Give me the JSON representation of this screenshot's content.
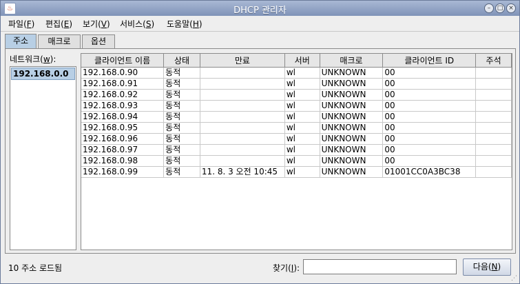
{
  "window": {
    "title": "DHCP 관리자"
  },
  "menu": [
    {
      "label": "파일(",
      "mnemonic": "F",
      "suffix": ")"
    },
    {
      "label": "편집(",
      "mnemonic": "E",
      "suffix": ")"
    },
    {
      "label": "보기(",
      "mnemonic": "V",
      "suffix": ")"
    },
    {
      "label": "서비스(",
      "mnemonic": "S",
      "suffix": ")"
    },
    {
      "label": "도움말(",
      "mnemonic": "H",
      "suffix": ")"
    }
  ],
  "tabs": [
    "주소",
    "매크로",
    "옵션"
  ],
  "network": {
    "label_prefix": "네트워크(",
    "label_mnemonic": "w",
    "label_suffix": "):",
    "items": [
      "192.168.0.0"
    ]
  },
  "table": {
    "columns": [
      "클라이언트 이름",
      "상태",
      "만료",
      "서버",
      "매크로",
      "클라이언트 ID",
      "주석"
    ],
    "rows": [
      [
        "192.168.0.90",
        "동적",
        "",
        "wl",
        "UNKNOWN",
        "00",
        ""
      ],
      [
        "192.168.0.91",
        "동적",
        "",
        "wl",
        "UNKNOWN",
        "00",
        ""
      ],
      [
        "192.168.0.92",
        "동적",
        "",
        "wl",
        "UNKNOWN",
        "00",
        ""
      ],
      [
        "192.168.0.93",
        "동적",
        "",
        "wl",
        "UNKNOWN",
        "00",
        ""
      ],
      [
        "192.168.0.94",
        "동적",
        "",
        "wl",
        "UNKNOWN",
        "00",
        ""
      ],
      [
        "192.168.0.95",
        "동적",
        "",
        "wl",
        "UNKNOWN",
        "00",
        ""
      ],
      [
        "192.168.0.96",
        "동적",
        "",
        "wl",
        "UNKNOWN",
        "00",
        ""
      ],
      [
        "192.168.0.97",
        "동적",
        "",
        "wl",
        "UNKNOWN",
        "00",
        ""
      ],
      [
        "192.168.0.98",
        "동적",
        "",
        "wl",
        "UNKNOWN",
        "00",
        ""
      ],
      [
        "192.168.0.99",
        "동적",
        "11. 8. 3 오전 10:45",
        "wl",
        "UNKNOWN",
        "01001CC0A3BC38",
        ""
      ]
    ]
  },
  "status": {
    "text": "10 주소 로드됨",
    "find_prefix": "찾기(",
    "find_mnemonic": "I",
    "find_suffix": "):",
    "find_value": "",
    "next_prefix": "다음(",
    "next_mnemonic": "N",
    "next_suffix": ")"
  }
}
